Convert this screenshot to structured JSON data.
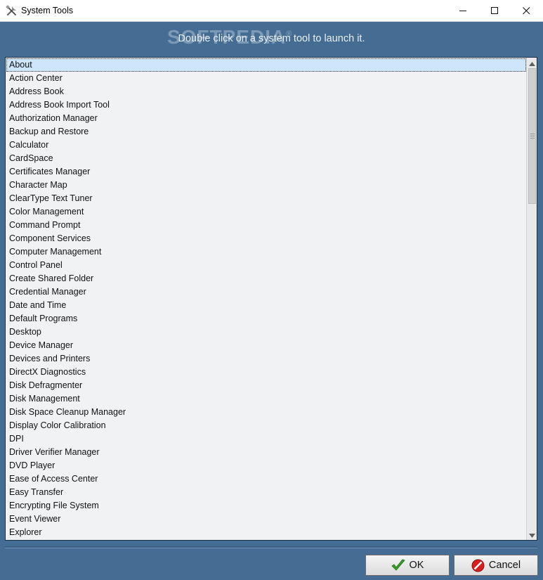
{
  "window": {
    "title": "System Tools",
    "minimize_icon": "minimize-icon",
    "maximize_icon": "maximize-icon",
    "close_icon": "close-icon"
  },
  "header": {
    "watermark": "SOFTPEDIA",
    "instruction": "Double click on a system tool to launch it."
  },
  "list": {
    "selected": "About",
    "items": [
      "About",
      "Action Center",
      "Address Book",
      "Address Book Import Tool",
      "Authorization Manager",
      "Backup and Restore",
      "Calculator",
      "CardSpace",
      "Certificates Manager",
      "Character Map",
      "ClearType Text Tuner",
      "Color Management",
      "Command Prompt",
      "Component Services",
      "Computer Management",
      "Control Panel",
      "Create Shared Folder",
      "Credential Manager",
      "Date and Time",
      "Default Programs",
      "Desktop",
      "Device Manager",
      "Devices and Printers",
      "DirectX Diagnostics",
      "Disk Defragmenter",
      "Disk Management",
      "Disk Space Cleanup Manager",
      "Display Color Calibration",
      "DPI",
      "Driver Verifier Manager",
      "DVD Player",
      "Ease of Access Center",
      "Easy Transfer",
      "Encrypting File System",
      "Event Viewer",
      "Explorer"
    ]
  },
  "buttons": {
    "ok_label": "OK",
    "cancel_label": "Cancel"
  },
  "colors": {
    "background": "#456d94",
    "selection": "#cde6fb"
  }
}
